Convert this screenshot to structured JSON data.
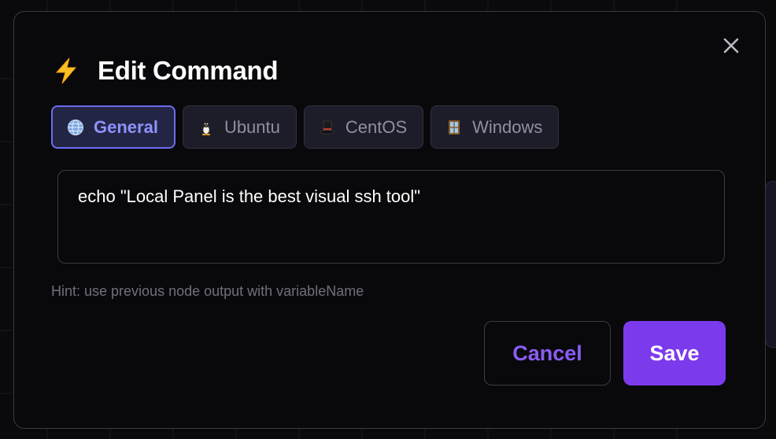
{
  "dialog": {
    "title": "Edit Command",
    "title_icon": "lightning-icon",
    "close_icon": "close-icon"
  },
  "tabs": [
    {
      "label": "General",
      "icon": "globe-icon",
      "active": true
    },
    {
      "label": "Ubuntu",
      "icon": "penguin-icon",
      "active": false
    },
    {
      "label": "CentOS",
      "icon": "top-hat-icon",
      "active": false
    },
    {
      "label": "Windows",
      "icon": "window-icon",
      "active": false
    }
  ],
  "command": {
    "value": "echo \"Local Panel is the best visual ssh tool\""
  },
  "hint": "Hint: use previous node output with variableName",
  "buttons": {
    "cancel": "Cancel",
    "save": "Save"
  },
  "colors": {
    "accent": "#7c3aed",
    "active_tab_border": "#6b6cf0",
    "background": "#09090b"
  }
}
